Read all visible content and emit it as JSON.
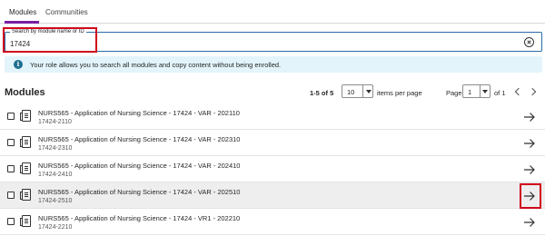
{
  "tabs": [
    {
      "label": "Modules",
      "active": true
    },
    {
      "label": "Communities",
      "active": false
    }
  ],
  "colors": {
    "accent": "#7a1fa2",
    "focus": "#2b6aa6",
    "highlight": "#d0021b",
    "info_bg": "#e3f4fb"
  },
  "search": {
    "label": "Search by module name or ID",
    "value": "17424",
    "clear_icon": "clear-circle-icon"
  },
  "info": {
    "icon": "info-icon",
    "icon_glyph": "i",
    "text": "Your role allows you to search all modules and copy content without being enrolled."
  },
  "list": {
    "heading": "Modules",
    "range": "1-5 of 5",
    "per_page": "10",
    "per_page_label": "items per page",
    "page_label": "Page",
    "page": "1",
    "of_pages": "of 1"
  },
  "rows": [
    {
      "title": "NURS565 - Application of Nursing Science - 17424 - VAR - 202110",
      "code": "17424-2110"
    },
    {
      "title": "NURS565 - Application of Nursing Science - 17424 - VAR - 202310",
      "code": "17424-2310"
    },
    {
      "title": "NURS565 - Application of Nursing Science - 17424 - VAR - 202410",
      "code": "17424-2410"
    },
    {
      "title": "NURS565 - Application of Nursing Science - 17424 - VAR - 202510",
      "code": "17424-2510"
    },
    {
      "title": "NURS565 - Application of Nursing Science - 17424 - VR1 - 202210",
      "code": "17424-2210"
    }
  ]
}
